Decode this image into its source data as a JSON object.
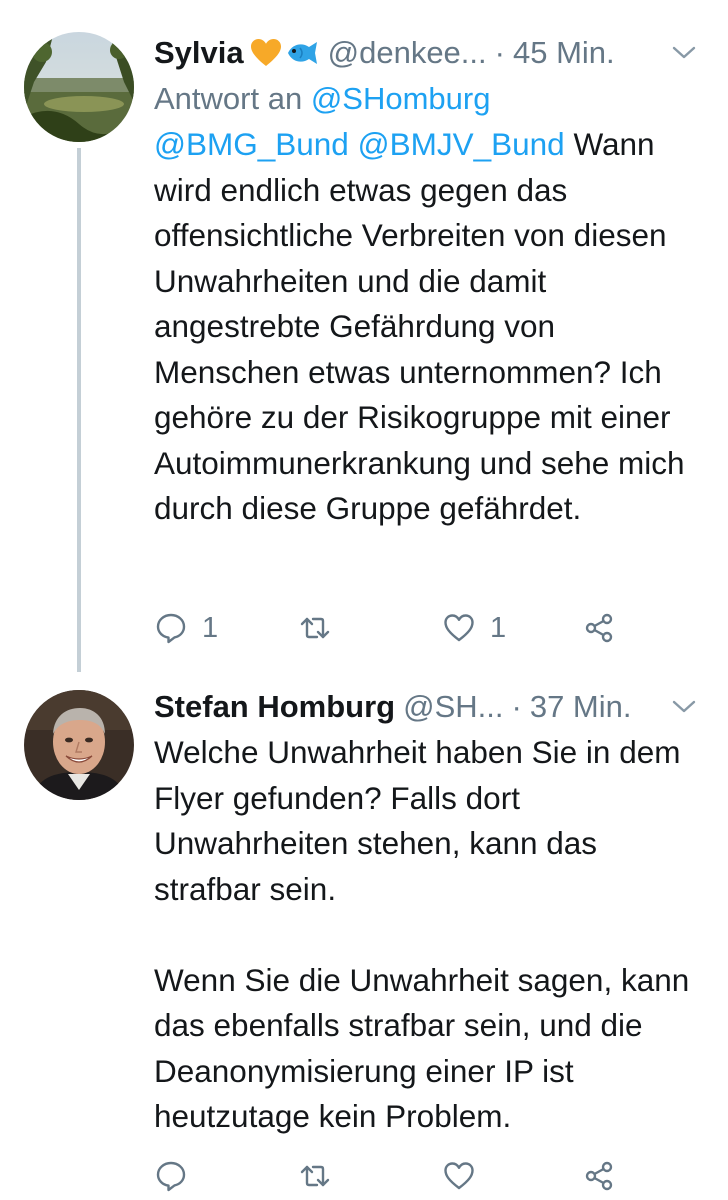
{
  "tweets": [
    {
      "name": "Sylvia",
      "handle": "@denkee...",
      "separator": "·",
      "time": "45 Min.",
      "reply_label": "Antwort an",
      "reply_mention": "@SHomburg",
      "mentions": [
        "@BMG_Bund",
        "@BMJV_Bund"
      ],
      "text": "Wann wird endlich etwas gegen das offensichtliche Verbreiten von diesen Unwahrheiten und die damit angestrebte Gefährdung von Menschen etwas unternommen? Ich gehöre zu der Risikogruppe mit einer Autoimmunerkrankung und sehe mich durch diese Gruppe gefährdet.",
      "reply_count": "1",
      "like_count": "1",
      "emoji_icons": [
        "orange-heart-icon",
        "fish-icon"
      ]
    },
    {
      "name": "Stefan Homburg",
      "handle": "@SH...",
      "separator": "·",
      "time": "37 Min.",
      "paragraphs": [
        "Welche Unwahrheit haben Sie in dem Flyer gefunden? Falls dort Unwahrheiten stehen, kann das strafbar sein.",
        "Wenn Sie die Unwahrheit sagen, kann das ebenfalls strafbar sein, und die Deanonymisierung einer IP ist heutzutage kein Problem."
      ]
    }
  ],
  "colors": {
    "text": "#14171a",
    "secondary": "#657786",
    "link": "#1da1f2",
    "thread_line": "#c4cfd6",
    "orange_heart": "#f7a928",
    "fish": "#2fa3e6"
  },
  "icons": [
    "chevron-down-icon",
    "reply-icon",
    "retweet-icon",
    "like-icon",
    "share-icon"
  ]
}
